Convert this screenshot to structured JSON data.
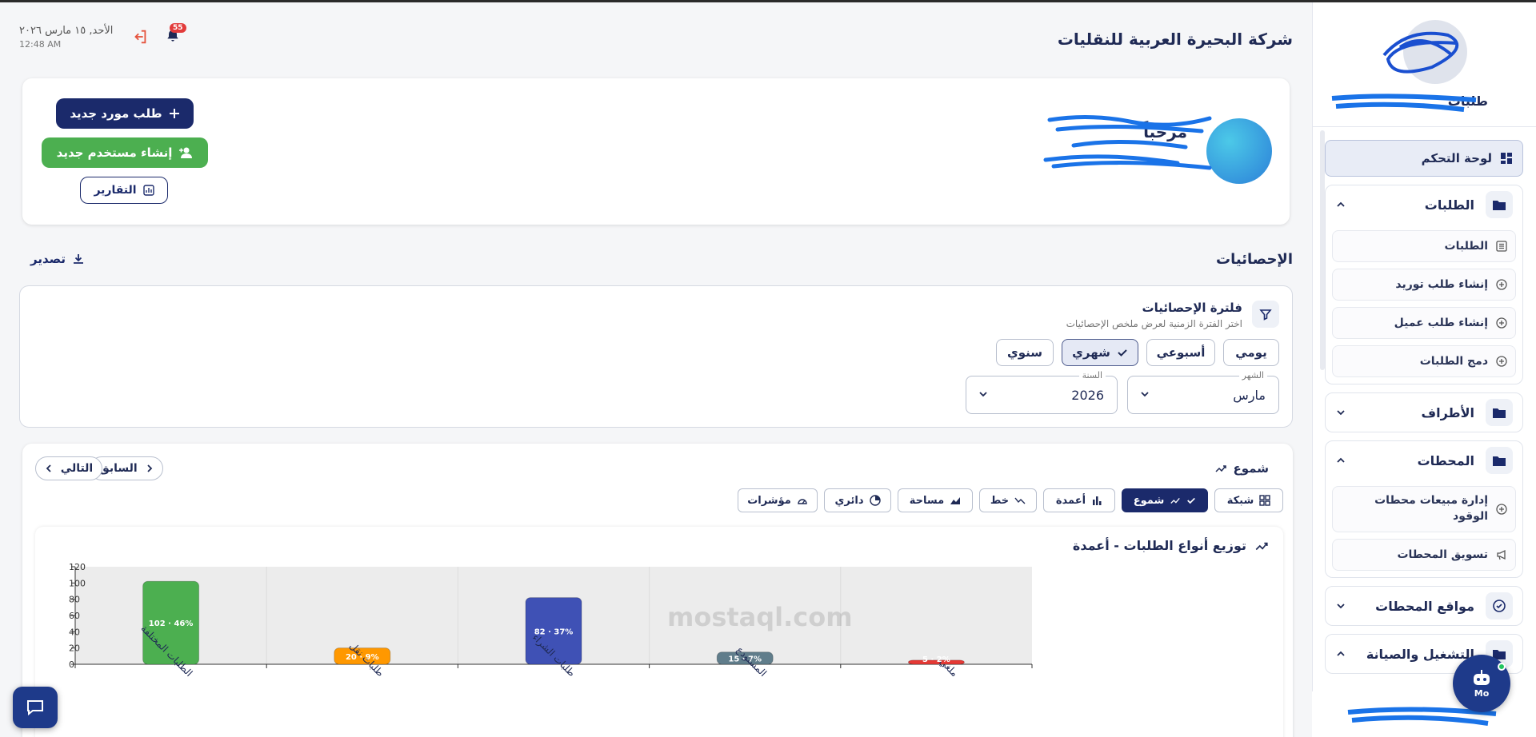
{
  "header": {
    "company": "شركة البحيرة العربية للنقليات",
    "date": "الأحد, ١٥ مارس ٢٠٢٦",
    "time": "12:48 AM",
    "notif_count": "55"
  },
  "sidebar": {
    "brand": "طلبات",
    "dashboard": "لوحة التحكم",
    "groups": [
      {
        "label": "الطلبات",
        "items": [
          "الطلبات",
          "إنشاء طلب توريد",
          "إنشاء طلب عميل",
          "دمج الطلبات"
        ]
      },
      {
        "label": "الأطراف"
      },
      {
        "label": "المحطات",
        "items": [
          "إدارة مبيعات محطات الوقود",
          "تسويق المحطات"
        ]
      },
      {
        "label": "مواقع المحطات"
      },
      {
        "label": "التشغيل والصيانة"
      }
    ],
    "bot_label": "Mo"
  },
  "welcome": {
    "greeting": "مرحباً",
    "new_supplier_btn": "طلب مورد جديد",
    "new_user_btn": "إنشاء مستخدم جديد",
    "reports_btn": "التقارير"
  },
  "stats": {
    "title": "الإحصائيات",
    "export": "تصدير"
  },
  "filter": {
    "title": "فلترة الإحصائيات",
    "desc": "اختر الفترة الزمنية لعرض ملخص الإحصائيات",
    "periods": [
      "يومي",
      "أسبوعي",
      "شهري",
      "سنوي"
    ],
    "active_period": "شهري",
    "month_label": "الشهر",
    "month_value": "مارس",
    "year_label": "السنة",
    "year_value": "2026"
  },
  "chart_panel": {
    "current_view": "شموع",
    "prev": "السابق",
    "next": "التالي",
    "types": [
      "شبكة",
      "شموع",
      "أعمدة",
      "خط",
      "مساحة",
      "دائري",
      "مؤشرات"
    ],
    "active_type": "شموع"
  },
  "chart_data": {
    "type": "bar",
    "title": "توزيع أنواع الطلبات - أعمدة",
    "categories": [
      "الطلبات المختلفة",
      "طلبات نقل",
      "طلبات الشراء",
      "المستودع",
      "ملغي"
    ],
    "values": [
      102,
      20,
      82,
      15,
      5
    ],
    "labels": [
      "46% · 102",
      "9% · 20",
      "37% · 82",
      "7% · 15",
      "2% · 5"
    ],
    "colors": [
      "#4caf50",
      "#ff9800",
      "#3f51b5",
      "#607d8b",
      "#e53935"
    ],
    "ylim": [
      0,
      120
    ],
    "yticks": [
      0,
      20,
      40,
      60,
      80,
      100,
      120
    ],
    "grid": true
  },
  "watermark": "mostaql.com"
}
